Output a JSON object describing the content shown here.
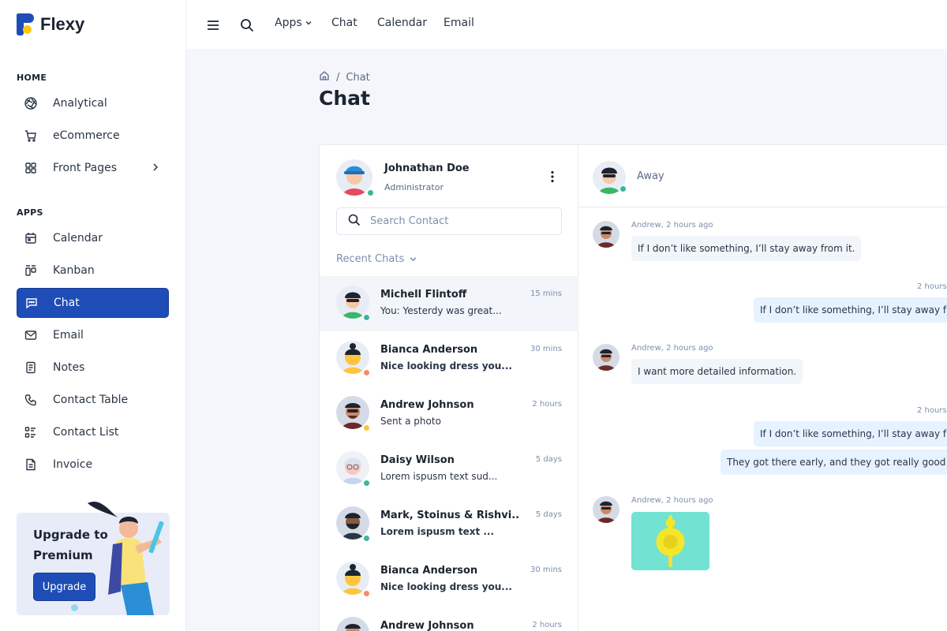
{
  "brand": {
    "name": "Flexy"
  },
  "sidebar": {
    "sections": [
      {
        "heading": "HOME"
      },
      {
        "heading": "APPS"
      }
    ],
    "items": [
      {
        "label": "Analytical",
        "icon": "aperture-icon"
      },
      {
        "label": "eCommerce",
        "icon": "cart-icon"
      },
      {
        "label": "Front Pages",
        "icon": "grid-icon"
      },
      {
        "label": "Calendar",
        "icon": "calendar-icon"
      },
      {
        "label": "Kanban",
        "icon": "kanban-icon"
      },
      {
        "label": "Chat",
        "icon": "message-icon",
        "active": true
      },
      {
        "label": "Email",
        "icon": "mail-icon"
      },
      {
        "label": "Notes",
        "icon": "notes-icon"
      },
      {
        "label": "Contact Table",
        "icon": "phone-icon"
      },
      {
        "label": "Contact List",
        "icon": "list-details-icon"
      },
      {
        "label": "Invoice",
        "icon": "invoice-icon"
      }
    ],
    "promo": {
      "title": "Upgrade to Premium",
      "button": "Upgrade"
    }
  },
  "topbar": {
    "links": [
      "Apps",
      "Chat",
      "Calendar",
      "Email"
    ]
  },
  "breadcrumb": {
    "current": "Chat"
  },
  "page": {
    "title": "Chat"
  },
  "profile": {
    "name": "Johnathan Doe",
    "role": "Administrator"
  },
  "search": {
    "placeholder": "Search Contact"
  },
  "recent": {
    "label": "Recent Chats"
  },
  "chats": [
    {
      "name": "Michell Flintoff",
      "message": "You: Yesterdy was great...",
      "time": "15 mins",
      "status": "online"
    },
    {
      "name": "Bianca Anderson",
      "message": "Nice looking dress you...",
      "time": "30 mins",
      "status": "busy"
    },
    {
      "name": "Andrew Johnson",
      "message": "Sent a photo",
      "time": "2 hours",
      "status": "away"
    },
    {
      "name": "Daisy Wilson",
      "message": "Lorem ispusm text sud...",
      "time": "5 days",
      "status": "online"
    },
    {
      "name": "Mark, Stoinus & Rishvi..",
      "message": "Lorem ispusm text ...",
      "time": "5 days",
      "status": "online"
    },
    {
      "name": "Bianca Anderson",
      "message": "Nice looking dress you...",
      "time": "30 mins",
      "status": "busy"
    },
    {
      "name": "Andrew Johnson",
      "message": "",
      "time": "2 hours",
      "status": "away"
    }
  ],
  "conversation": {
    "status": "Away",
    "messages": [
      {
        "meta": "Andrew, 2 hours ago",
        "text": "If I don’t like something, I’ll stay away from it."
      },
      {
        "meta": "2 hours",
        "text": "If I don’t like something, I’ll stay away from it."
      },
      {
        "meta": "Andrew, 2 hours ago",
        "text": "I want more detailed information."
      },
      {
        "meta": "2 hours",
        "text": "If I don’t like something, I’ll stay away from it."
      },
      {
        "text": "They got there early, and they got really good seats."
      },
      {
        "meta": "Andrew, 2 hours ago",
        "image": "yellow-object-photo"
      }
    ]
  },
  "colors": {
    "primary": "#1e4db7",
    "accent": "#fdc90f",
    "online": "#39b69a",
    "busy": "#fa896b",
    "away": "#ffc43d"
  }
}
